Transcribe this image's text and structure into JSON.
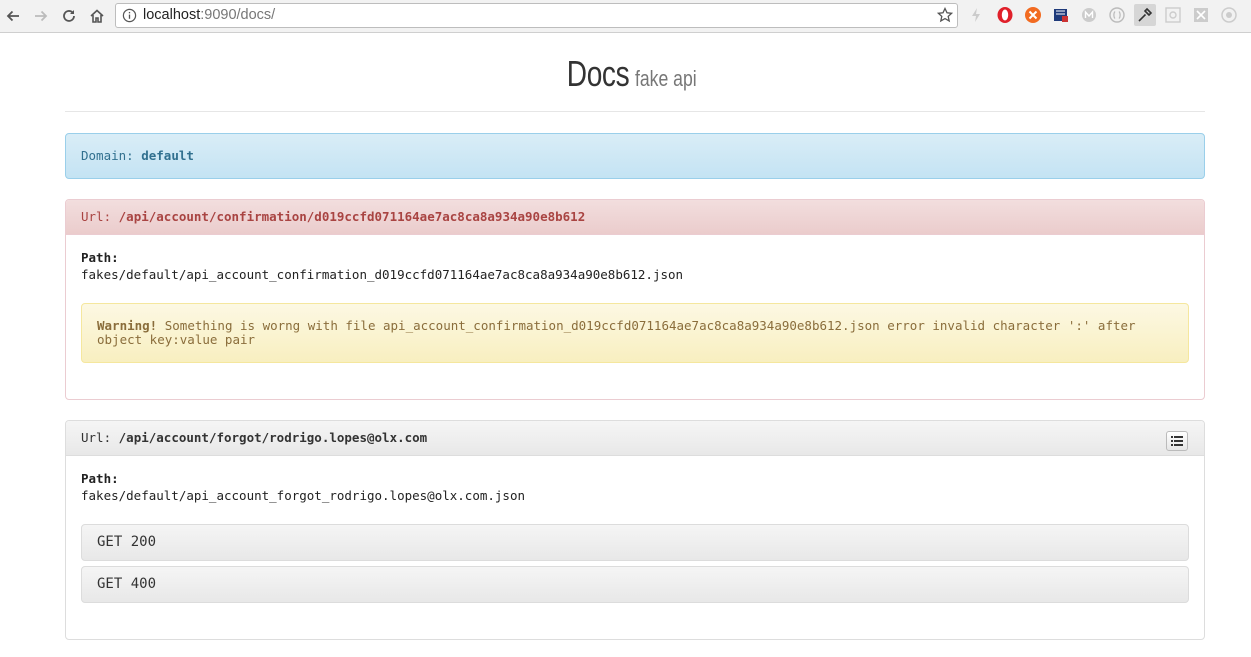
{
  "browser": {
    "url_host": "localhost",
    "url_rest": ":9090/docs/"
  },
  "header": {
    "title": "Docs",
    "subtitle": "fake api"
  },
  "domain": {
    "label": "Domain:",
    "value": "default"
  },
  "endpoints": [
    {
      "url_label": "Url:",
      "url": "/api/account/confirmation/d019ccfd071164ae7ac8ca8a934a90e8b612",
      "path_label": "Path:",
      "path": "fakes/default/api_account_confirmation_d019ccfd071164ae7ac8ca8a934a90e8b612.json",
      "warning_label": "Warning!",
      "warning_text": "Something is worng with file api_account_confirmation_d019ccfd071164ae7ac8ca8a934a90e8b612.json error invalid character ':' after object key:value pair"
    },
    {
      "url_label": "Url:",
      "url": "/api/account/forgot/rodrigo.lopes@olx.com",
      "path_label": "Path:",
      "path": "fakes/default/api_account_forgot_rodrigo.lopes@olx.com.json",
      "methods": [
        "GET 200",
        "GET 400"
      ]
    }
  ],
  "colors": {
    "info_bg": "#d9edf7",
    "danger_bg": "#f2dede",
    "warning_bg": "#fcf8e3"
  }
}
